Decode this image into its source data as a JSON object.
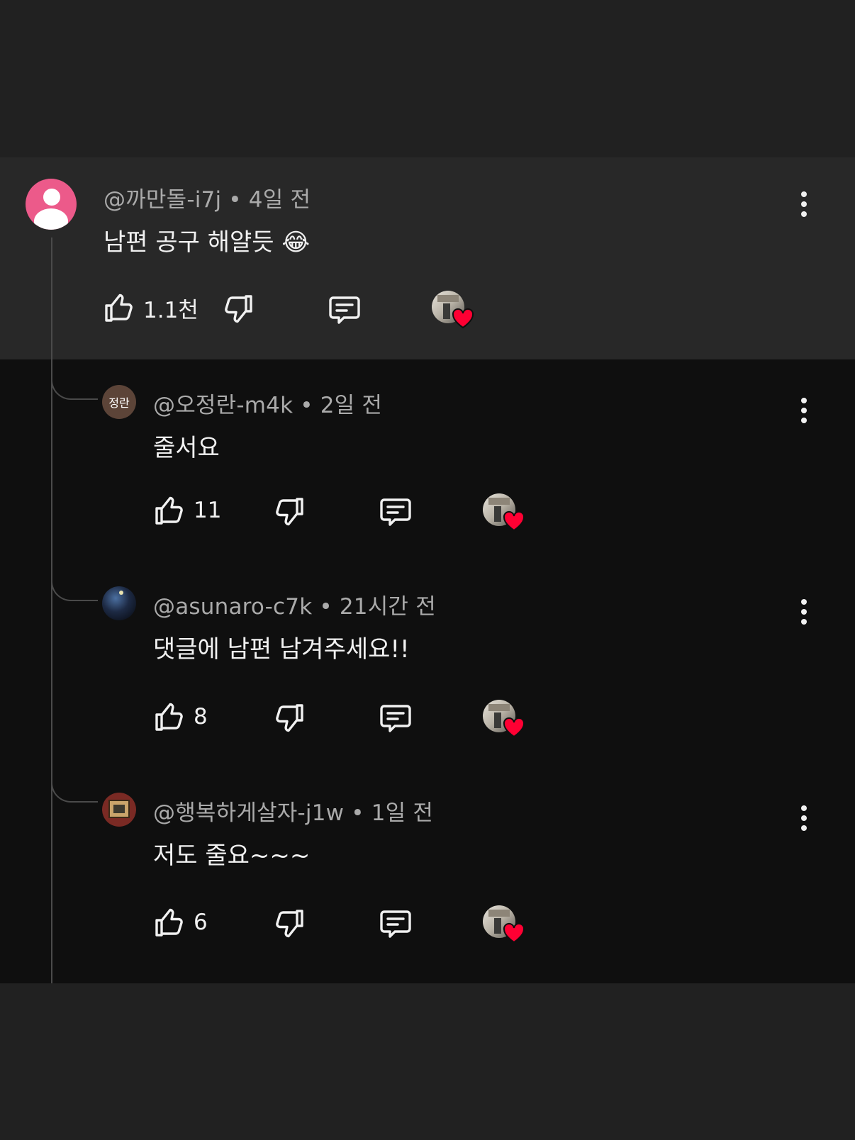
{
  "comment": {
    "author": "@까만돌-i7j",
    "separator": "•",
    "time": "4일 전",
    "text": "남편 공구 해얄듯 😂",
    "likes": "1.1천"
  },
  "replies": [
    {
      "avatar_text": "정란",
      "author": "@오정란-m4k",
      "separator": "•",
      "time": "2일 전",
      "text": "줄서요",
      "likes": "11"
    },
    {
      "author": "@asunaro-c7k",
      "separator": "•",
      "time": "21시간 전",
      "text": "댓글에 남편 남겨주세요!!",
      "likes": "8"
    },
    {
      "author": "@행복하게살자-j1w",
      "separator": "•",
      "time": "1일 전",
      "text": "저도 줄요~~~",
      "likes": "6"
    }
  ],
  "icons": {
    "like": "thumbs-up-icon",
    "dislike": "thumbs-down-icon",
    "reply": "comment-icon",
    "creator_heart": "creator-heart-icon",
    "more": "more-vertical-icon"
  },
  "colors": {
    "heart": "#ff0033",
    "main_avatar": "#ec5a8a"
  }
}
